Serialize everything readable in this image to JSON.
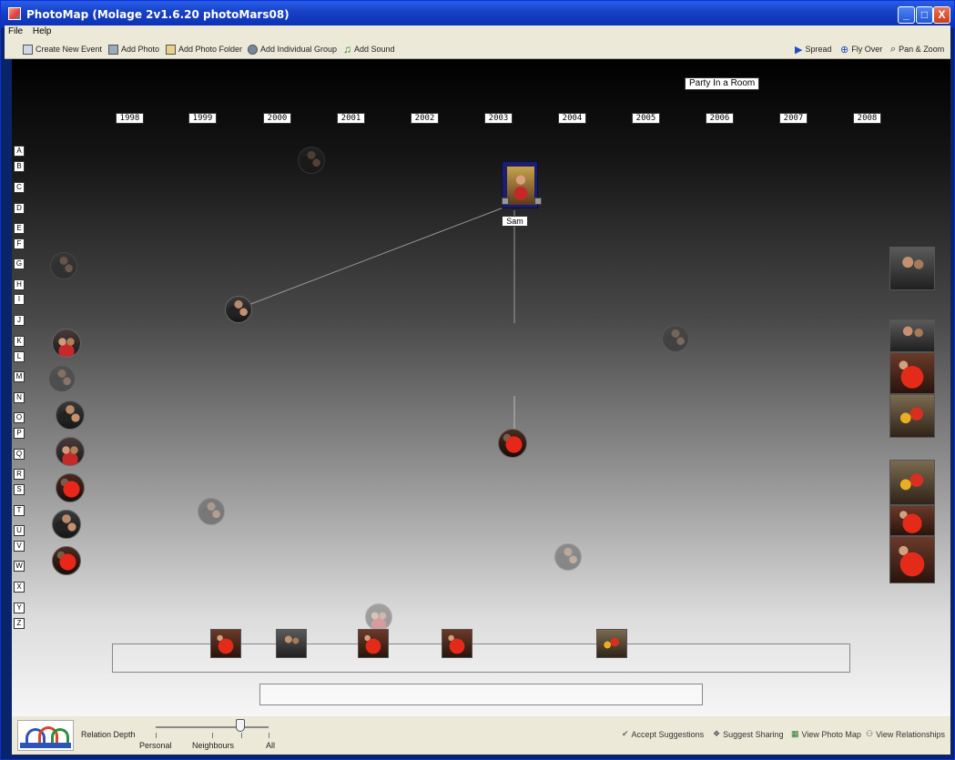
{
  "window": {
    "title": "PhotoMap (Molage 2v1.6.20 photoMars08)",
    "minimize": "_",
    "maximize": "□",
    "close": "X"
  },
  "menu": {
    "file": "File",
    "help": "Help"
  },
  "toolbar": {
    "create_event": "Create New Event",
    "add_photo": "Add Photo",
    "add_photo_folder": "Add Photo Folder",
    "add_group": "Add Individual Group",
    "add_sound": "Add Sound",
    "spread": "Spread",
    "fly_over": "Fly Over",
    "pan_zoom": "Pan & Zoom"
  },
  "map": {
    "event_label": "Party In a Room",
    "node_label": "Sam",
    "years": [
      "1998",
      "1999",
      "2000",
      "2001",
      "2002",
      "2003",
      "2004",
      "2005",
      "2006",
      "2007",
      "2008"
    ],
    "letters": [
      "A",
      "B",
      "C",
      "D",
      "E",
      "F",
      "G",
      "H",
      "I",
      "J",
      "K",
      "L",
      "M",
      "N",
      "O",
      "P",
      "Q",
      "R",
      "S",
      "T",
      "U",
      "V",
      "W",
      "X",
      "Y",
      "Z"
    ]
  },
  "bottom": {
    "relation_depth": "Relation Depth",
    "slider_labels": [
      "Personal",
      "Neighbours",
      "All"
    ],
    "relation_depth_value": "Neighbours-All",
    "accept_suggestions": "Accept Suggestions",
    "suggest_sharing": "Suggest Sharing",
    "view_photo_map": "View Photo Map",
    "view_relationships": "View Relationships"
  }
}
